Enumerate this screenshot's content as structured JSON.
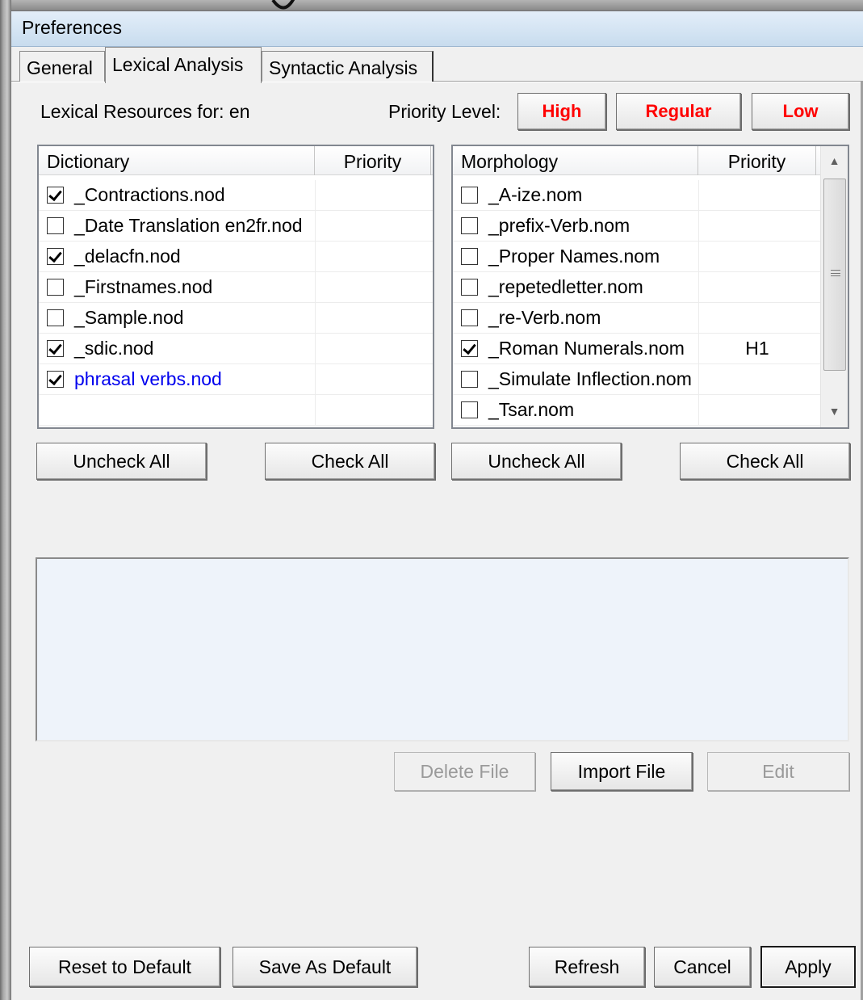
{
  "window": {
    "title": "Preferences"
  },
  "tabs": [
    {
      "label": "General"
    },
    {
      "label": "Lexical Analysis"
    },
    {
      "label": "Syntactic Analysis"
    }
  ],
  "lexical": {
    "resources_label": "Lexical Resources for: en",
    "priority_label": "Priority Level:",
    "priority_buttons": {
      "high": "High",
      "regular": "Regular",
      "low": "Low"
    },
    "priority_color": "#ff0000"
  },
  "dictionary": {
    "columns": {
      "name": "Dictionary",
      "priority": "Priority"
    },
    "rows": [
      {
        "name": "_Contractions.nod",
        "checked": true,
        "priority": ""
      },
      {
        "name": "_Date Translation en2fr.nod",
        "checked": false,
        "priority": ""
      },
      {
        "name": "_delacfn.nod",
        "checked": true,
        "priority": ""
      },
      {
        "name": "_Firstnames.nod",
        "checked": false,
        "priority": ""
      },
      {
        "name": "_Sample.nod",
        "checked": false,
        "priority": ""
      },
      {
        "name": "_sdic.nod",
        "checked": true,
        "priority": ""
      },
      {
        "name": "phrasal verbs.nod",
        "checked": true,
        "priority": "",
        "highlight_color": "#0000ee"
      }
    ],
    "uncheck_all": "Uncheck All",
    "check_all": "Check All"
  },
  "morphology": {
    "columns": {
      "name": "Morphology",
      "priority": "Priority"
    },
    "rows": [
      {
        "name": "_A-ize.nom",
        "checked": false,
        "priority": ""
      },
      {
        "name": "_prefix-Verb.nom",
        "checked": false,
        "priority": ""
      },
      {
        "name": "_Proper Names.nom",
        "checked": false,
        "priority": ""
      },
      {
        "name": "_repetedletter.nom",
        "checked": false,
        "priority": ""
      },
      {
        "name": "_re-Verb.nom",
        "checked": false,
        "priority": ""
      },
      {
        "name": "_Roman Numerals.nom",
        "checked": true,
        "priority": "H1"
      },
      {
        "name": "_Simulate Inflection.nom",
        "checked": false,
        "priority": ""
      },
      {
        "name": "_Tsar.nom",
        "checked": false,
        "priority": ""
      }
    ],
    "uncheck_all": "Uncheck All",
    "check_all": "Check All"
  },
  "file_buttons": {
    "delete": "Delete File",
    "import": "Import File",
    "edit": "Edit"
  },
  "footer": {
    "reset": "Reset to Default",
    "save_default": "Save As Default",
    "refresh": "Refresh",
    "cancel": "Cancel",
    "apply": "Apply"
  }
}
